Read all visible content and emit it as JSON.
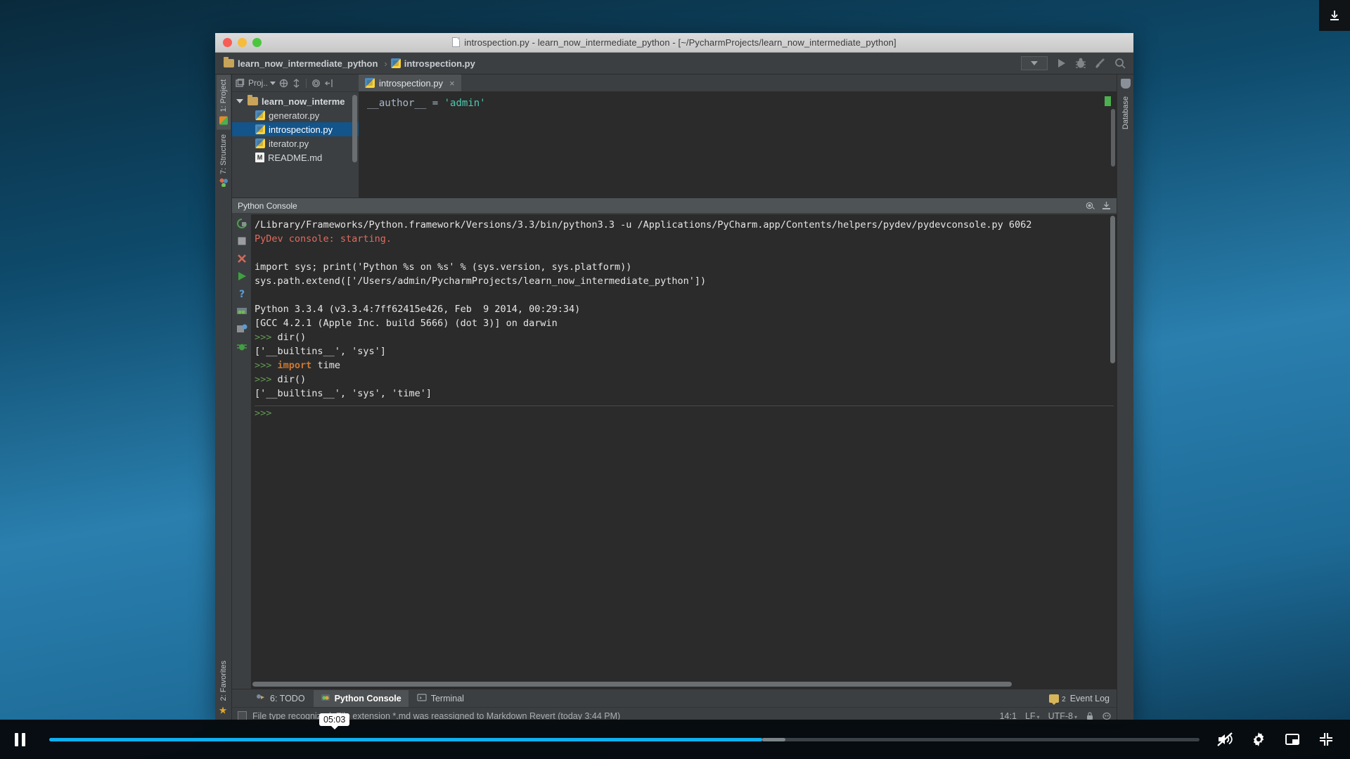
{
  "video": {
    "top_right_icon": "download-icon",
    "pause_label": "Pause",
    "current_time": "05:03",
    "progress_percent": 62,
    "buffer_percent": 64,
    "controls": [
      {
        "name": "mute-button",
        "label": "Unmute"
      },
      {
        "name": "settings-button",
        "label": "Settings"
      },
      {
        "name": "pip-button",
        "label": "Picture in picture"
      },
      {
        "name": "exit-fullscreen-button",
        "label": "Exit full screen"
      }
    ]
  },
  "window": {
    "title": "introspection.py - learn_now_intermediate_python - [~/PycharmProjects/learn_now_intermediate_python]",
    "traffic": [
      "close",
      "minimize",
      "zoom"
    ]
  },
  "navbar": {
    "crumbs": [
      {
        "icon": "folder-icon",
        "label": "learn_now_intermediate_python"
      },
      {
        "icon": "python-file-icon",
        "label": "introspection.py"
      }
    ],
    "separator": "›",
    "actions": [
      {
        "name": "run-configuration-selector",
        "label": ""
      },
      {
        "name": "run-button",
        "label": "Run"
      },
      {
        "name": "debug-button",
        "label": "Debug"
      },
      {
        "name": "coverage-button",
        "label": "Run with Coverage"
      },
      {
        "name": "search-everywhere-button",
        "label": "Search Everywhere"
      }
    ]
  },
  "left_stripe": {
    "top": [
      {
        "label": "1: Project",
        "accesskey": "1",
        "icon": "project-icon",
        "active": true
      },
      {
        "label": "7: Structure",
        "accesskey": "7",
        "icon": "structure-icon",
        "active": false
      }
    ],
    "bottom": [
      {
        "label": "2: Favorites",
        "accesskey": "2",
        "icon": "star-icon",
        "active": false
      }
    ]
  },
  "right_stripe": {
    "items": [
      {
        "label": "Database",
        "icon": "database-icon"
      }
    ]
  },
  "project": {
    "toolbar_label": "Proj..",
    "toolbar_actions": [
      {
        "name": "select-opened-file-icon",
        "label": "Select Opened File"
      },
      {
        "name": "collapse-all-icon",
        "label": "Collapse All"
      },
      {
        "name": "settings-gear-icon",
        "label": "Settings"
      },
      {
        "name": "hide-icon",
        "label": "Hide"
      }
    ],
    "tree": [
      {
        "label": "learn_now_interme",
        "icon": "folder-icon",
        "depth": 0,
        "expanded": true,
        "selected": false
      },
      {
        "label": "generator.py",
        "icon": "python-file-icon",
        "depth": 1,
        "selected": false
      },
      {
        "label": "introspection.py",
        "icon": "python-file-icon",
        "depth": 1,
        "selected": true
      },
      {
        "label": "iterator.py",
        "icon": "python-file-icon",
        "depth": 1,
        "selected": false
      },
      {
        "label": "README.md",
        "icon": "markdown-file-icon",
        "depth": 1,
        "selected": false
      }
    ]
  },
  "editor": {
    "tabs": [
      {
        "label": "introspection.py",
        "icon": "python-file-icon",
        "close": "×",
        "active": true
      }
    ],
    "code": {
      "name": "__author__",
      "equals": "=",
      "value": "'admin'"
    }
  },
  "console": {
    "header_title": "Python Console",
    "header_actions": [
      {
        "name": "console-settings-icon",
        "label": "Settings"
      },
      {
        "name": "console-hide-icon",
        "label": "Hide"
      }
    ],
    "toolbar_actions": [
      {
        "name": "rerun-icon",
        "label": "Rerun"
      },
      {
        "name": "stop-icon",
        "label": "Stop"
      },
      {
        "name": "close-icon",
        "label": "Close"
      },
      {
        "name": "execute-icon",
        "label": "Execute"
      },
      {
        "name": "help-icon",
        "label": "Help"
      },
      {
        "name": "show-variables-icon",
        "label": "Show Variables"
      },
      {
        "name": "command-history-icon",
        "label": "Command History"
      },
      {
        "name": "attach-debugger-icon",
        "label": "Attach Debugger"
      }
    ],
    "lines": [
      {
        "text": "/Library/Frameworks/Python.framework/Versions/3.3/bin/python3.3 -u /Applications/PyCharm.app/Contents/helpers/pydev/pydevconsole.py 6062",
        "class": "c-white"
      },
      {
        "text": "PyDev console: starting.",
        "class": "c-red"
      },
      {
        "text": "",
        "class": "c-white"
      },
      {
        "text": "import sys; print('Python %s on %s' % (sys.version, sys.platform))",
        "class": "c-white"
      },
      {
        "text": "sys.path.extend(['/Users/admin/PycharmProjects/learn_now_intermediate_python'])",
        "class": "c-white"
      },
      {
        "text": "",
        "class": "c-white"
      },
      {
        "text": "Python 3.3.4 (v3.3.4:7ff62415e426, Feb  9 2014, 00:29:34)",
        "class": "c-white"
      },
      {
        "text": "[GCC 4.2.1 (Apple Inc. build 5666) (dot 3)] on darwin",
        "class": "c-white"
      }
    ],
    "session": [
      {
        "prompt": ">>>",
        "code": "dir()",
        "kw": ""
      },
      {
        "prompt": "",
        "code": "['__builtins__', 'sys']",
        "kw": ""
      },
      {
        "prompt": ">>>",
        "code": " time",
        "kw": "import"
      },
      {
        "prompt": ">>>",
        "code": "dir()",
        "kw": ""
      },
      {
        "prompt": "",
        "code": "['__builtins__', 'sys', 'time']",
        "kw": ""
      }
    ],
    "current_prompt": ">>>"
  },
  "bottom_tabs": [
    {
      "label": "6: TODO",
      "accesskey": "6",
      "icon": "todo-icon",
      "active": false
    },
    {
      "label": "Python Console",
      "accesskey": "",
      "icon": "python-console-icon",
      "active": true
    },
    {
      "label": "Terminal",
      "accesskey": "",
      "icon": "terminal-icon",
      "active": false
    }
  ],
  "event_log": {
    "label": "Event Log",
    "count": "2",
    "icon": "message-icon"
  },
  "statusbar": {
    "message": "File type recognized: File extension *.md was reassigned to Markdown Revert (today 3:44 PM)",
    "caret": "14:1",
    "line_sep": "LF",
    "encoding": "UTF-8",
    "lock_icon": "lock-icon",
    "hector_icon": "hector-icon"
  }
}
